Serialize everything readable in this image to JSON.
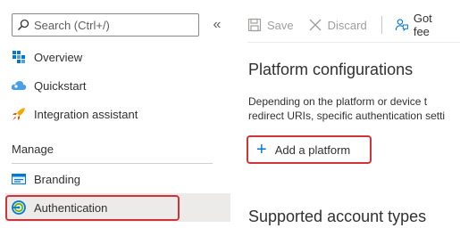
{
  "sidebar": {
    "search_placeholder": "Search (Ctrl+/)",
    "collapse_glyph": "«",
    "items": [
      {
        "label": "Overview",
        "icon": "grid-icon"
      },
      {
        "label": "Quickstart",
        "icon": "cloud-icon"
      },
      {
        "label": "Integration assistant",
        "icon": "rocket-icon"
      }
    ],
    "section_header": "Manage",
    "manage_items": [
      {
        "label": "Branding",
        "icon": "branding-icon"
      },
      {
        "label": "Authentication",
        "icon": "authentication-icon",
        "selected": true
      }
    ]
  },
  "toolbar": {
    "save_label": "Save",
    "discard_label": "Discard",
    "feedback_label": "Got fee"
  },
  "main": {
    "platform_title": "Platform configurations",
    "platform_desc_line1": "Depending on the platform or device t",
    "platform_desc_line2": "redirect URIs, specific authentication setti",
    "add_platform_label": "Add a platform",
    "supported_title": "Supported account types"
  },
  "colors": {
    "highlight": "#d13438",
    "accent": "#0078d4",
    "selected_bg": "#edebe9",
    "disabled_text": "#a19f9d"
  }
}
